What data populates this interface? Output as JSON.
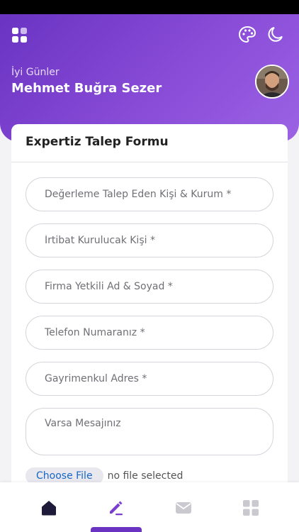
{
  "header": {
    "greeting": "İyi Günler",
    "user_name": "Mehmet Buğra Sezer"
  },
  "form": {
    "title": "Expertiz Talep Formu",
    "fields": [
      {
        "placeholder": "Değerleme Talep Eden Kişi & Kurum *",
        "value": ""
      },
      {
        "placeholder": "İrtibat Kurulucak Kişi *",
        "value": ""
      },
      {
        "placeholder": "Firma Yetkili Ad & Soyad *",
        "value": ""
      },
      {
        "placeholder": "Telefon Numaranız *",
        "value": ""
      },
      {
        "placeholder": "Gayrimenkul Adres *",
        "value": ""
      }
    ],
    "message_placeholder": "Varsa Mesajınız",
    "file_button": "Choose File",
    "file_status": "no file selected"
  },
  "nav": {
    "items": [
      "home-icon",
      "edit-icon",
      "mail-icon",
      "grid-icon"
    ],
    "active": 1
  },
  "colors": {
    "accent": "#6a33c2",
    "nav_active": "#7b3fd0",
    "nav_inactive": "#c9c9cf",
    "nav_home": "#1e1b3a"
  }
}
